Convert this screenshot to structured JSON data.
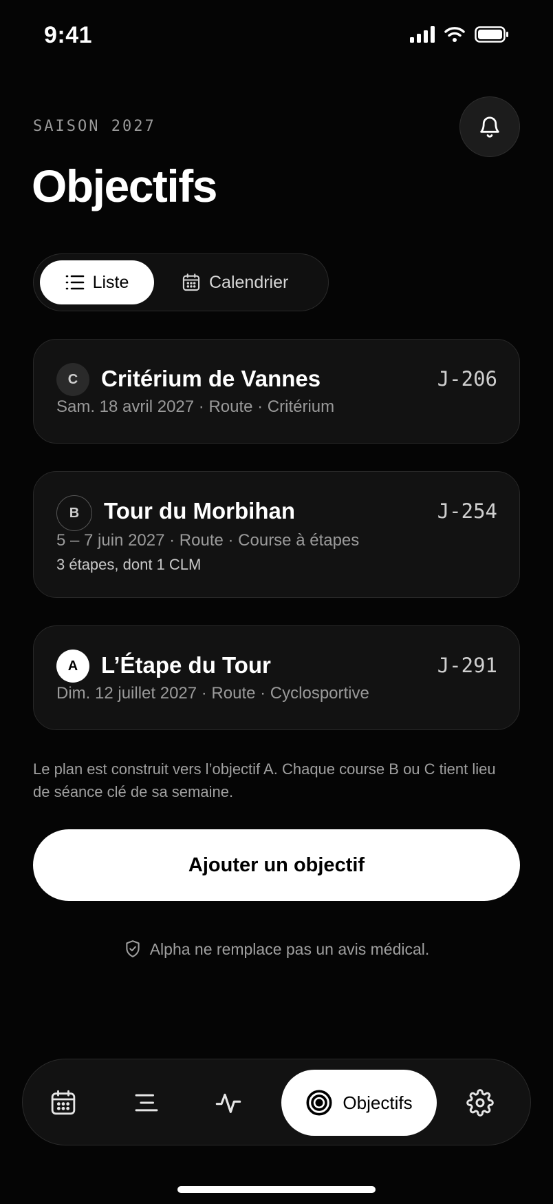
{
  "status": {
    "time": "9:41"
  },
  "header": {
    "season": "SAISON 2027",
    "title": "Objectifs"
  },
  "view_toggle": {
    "list_label": "Liste",
    "calendar_label": "Calendrier",
    "selected": "Liste"
  },
  "goals": [
    {
      "priority": "C",
      "title": "Critérium de Vannes",
      "countdown": "J-206",
      "meta": "Sam. 18 avril 2027 · Route · Critérium",
      "detail": ""
    },
    {
      "priority": "B",
      "title": "Tour du Morbihan",
      "countdown": "J-254",
      "meta": "5 – 7 juin 2027 · Route · Course à étapes",
      "detail": "3 étapes, dont 1 CLM"
    },
    {
      "priority": "A",
      "title": "L’Étape du Tour",
      "countdown": "J-291",
      "meta": "Dim. 12 juillet 2027 · Route · Cyclosportive",
      "detail": ""
    }
  ],
  "note": "Le plan est construit vers l’objectif A. Chaque course B ou C tient lieu de séance clé de sa semaine.",
  "add_button": "Ajouter un objectif",
  "disclaimer": "Alpha ne remplace pas un avis médical.",
  "tabbar": {
    "active_label": "Objectifs",
    "icons": [
      "calendar-icon",
      "list-icon",
      "activity-icon",
      "target-icon",
      "settings-icon"
    ]
  },
  "colors": {
    "background": "#050505",
    "card": "#121212",
    "accent": "#ffffff",
    "muted": "#9a9a9a"
  }
}
